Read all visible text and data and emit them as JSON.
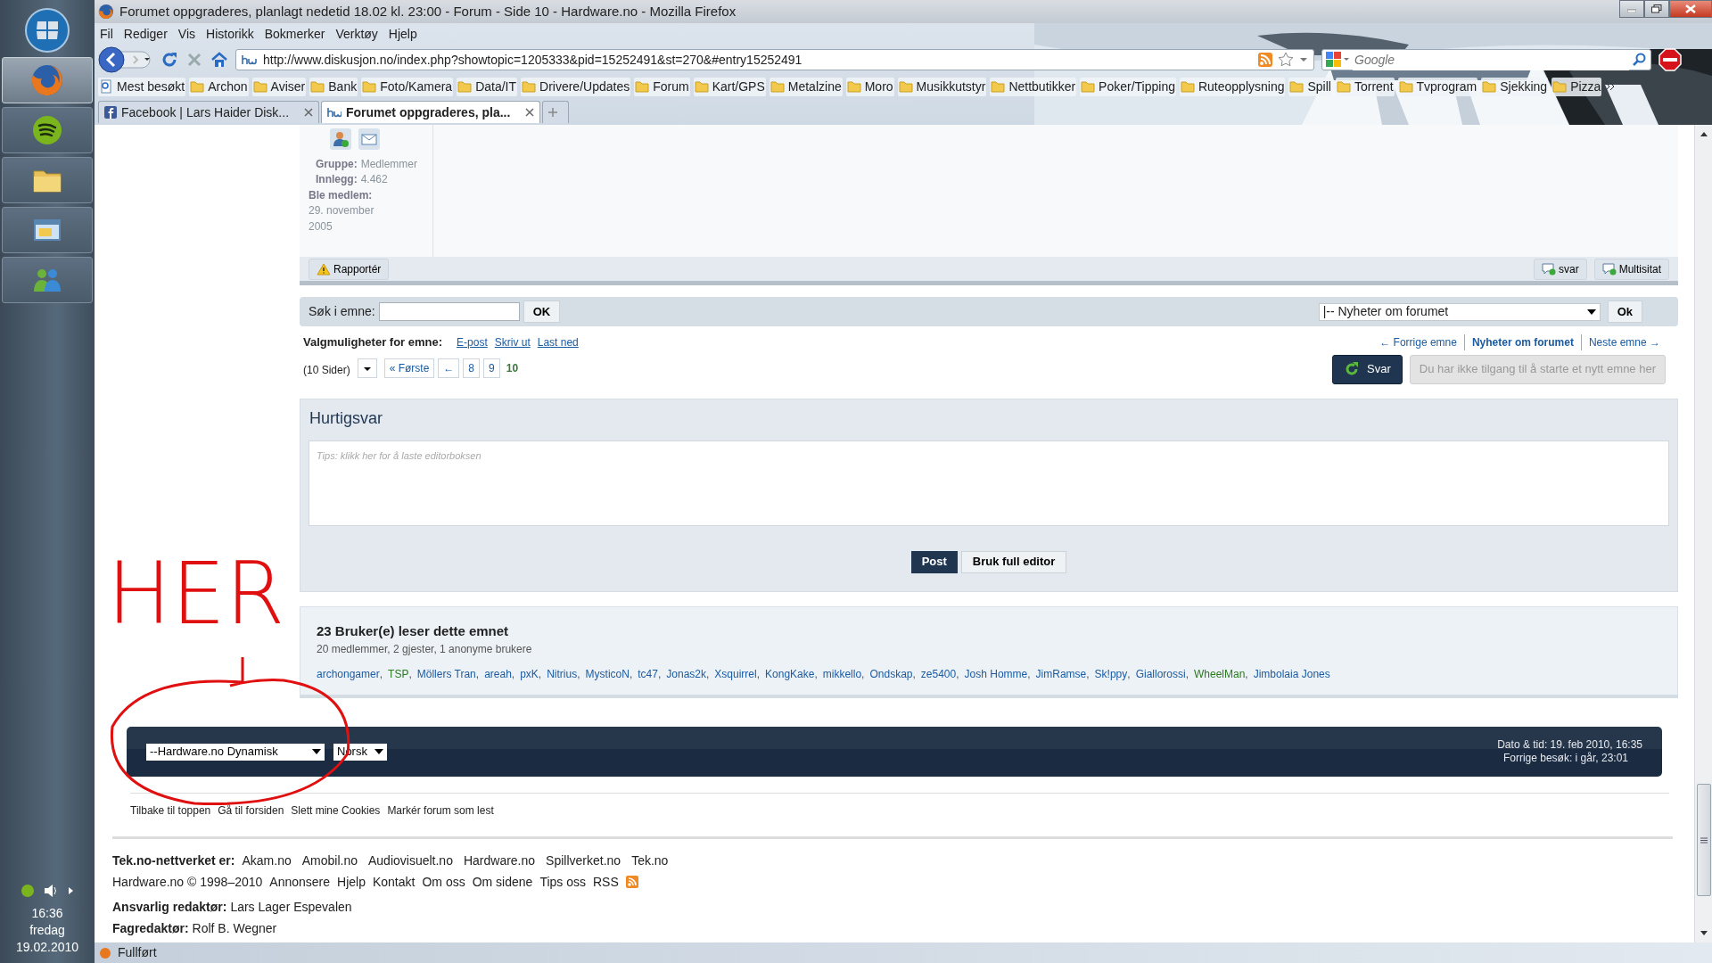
{
  "taskbar": {
    "apps": [
      {
        "kind": "firefox",
        "selected": true
      },
      {
        "kind": "spotify",
        "selected": false
      },
      {
        "kind": "folder",
        "selected": false
      },
      {
        "kind": "window",
        "selected": false
      },
      {
        "kind": "people",
        "selected": false
      }
    ]
  },
  "clock": {
    "time": "16:36",
    "day": "fredag",
    "date": "19.02.2010"
  },
  "window": {
    "title": "Forumet oppgraderes, planlagt nedetid 18.02 kl. 23:00 - Forum - Side 10 - Hardware.no - Mozilla Firefox"
  },
  "menu": [
    "Fil",
    "Rediger",
    "Vis",
    "Historikk",
    "Bokmerker",
    "Verktøy",
    "Hjelp"
  ],
  "address": {
    "url": "http://www.diskusjon.no/index.php?showtopic=1205333&pid=15252491&st=270&#entry15252491"
  },
  "search": {
    "placeholder": "Google"
  },
  "bookmarks": [
    "Mest besøkt",
    "Archon",
    "Aviser",
    "Bank",
    "Foto/Kamera",
    "Data/IT",
    "Drivere/Updates",
    "Forum",
    "Kart/GPS",
    "Metalzine",
    "Moro",
    "Musikkutstyr",
    "Nettbutikker",
    "Poker/Tipping",
    "Ruteopplysning",
    "Spill",
    "Torrent",
    "Tvprogram",
    "Sjekking",
    "Pizza"
  ],
  "tabs": [
    {
      "label": "Facebook | Lars Haider Disk...",
      "selected": false,
      "kind": "facebook"
    },
    {
      "label": "Forumet oppgraderes, pla...",
      "selected": true,
      "kind": "hw"
    }
  ],
  "post": {
    "profile": [
      {
        "label": "Gruppe:",
        "value": "Medlemmer"
      },
      {
        "label": "Innlegg:",
        "value": "4.462"
      }
    ],
    "joined_label": "Ble medlem:",
    "joined": "29. november 2005",
    "report": "Rapportér",
    "actions": [
      "svar",
      "Multisitat"
    ]
  },
  "topic_search": {
    "label": "Søk i emne:",
    "button": "OK",
    "forum_select": "|-- Nyheter om forumet",
    "go": "Ok"
  },
  "options": {
    "label": "Valgmuligheter for emne:",
    "links": [
      "E-post",
      "Skriv ut",
      "Last ned"
    ]
  },
  "topic_nav": [
    {
      "label": "← Forrige emne",
      "current": false
    },
    {
      "label": "Nyheter om forumet",
      "current": true
    },
    {
      "label": "Neste emne →",
      "current": false
    }
  ],
  "pagination": {
    "pages_label": "(10 Sider)",
    "first": "« Første",
    "prev": "←",
    "pages": [
      {
        "label": "8",
        "selected": false
      },
      {
        "label": "9",
        "selected": false
      },
      {
        "label": "10",
        "selected": true
      }
    ]
  },
  "reply_button": "Svar",
  "new_topic_button": {
    "label": "Du har ikke tilgang til å starte et nytt emne her",
    "disabled": true
  },
  "quick_reply": {
    "title": "Hurtigsvar",
    "placeholder": "Tips: klikk her for å laste editorboksen",
    "buttons": [
      "Post",
      "Bruk full editor"
    ]
  },
  "readers": {
    "separator": ",",
    "title": "23 Bruker(e) leser dette emnet",
    "summary": "20 medlemmer, 2 gjester, 1 anonyme brukere",
    "users": [
      {
        "name": "archongamer",
        "color": "#1d5ba0"
      },
      {
        "name": "TSP",
        "color": "#2a7a1e"
      },
      {
        "name": "Möllers Tran",
        "color": "#1d5ba0"
      },
      {
        "name": "areah",
        "color": "#1d5ba0"
      },
      {
        "name": "pxK",
        "color": "#1d5ba0"
      },
      {
        "name": "Nitrius",
        "color": "#1d5ba0"
      },
      {
        "name": "MysticoN",
        "color": "#1d5ba0"
      },
      {
        "name": "tc47",
        "color": "#1d5ba0"
      },
      {
        "name": "Jonas2k",
        "color": "#1d5ba0"
      },
      {
        "name": "Xsquirrel",
        "color": "#1d5ba0"
      },
      {
        "name": "KongKake",
        "color": "#1d5ba0"
      },
      {
        "name": "mikkello",
        "color": "#1d5ba0"
      },
      {
        "name": "Ondskap",
        "color": "#1d5ba0"
      },
      {
        "name": "ze5400",
        "color": "#1d5ba0"
      },
      {
        "name": "Josh Homme",
        "color": "#1d5ba0"
      },
      {
        "name": "JimRamse",
        "color": "#1d5ba0"
      },
      {
        "name": "Sk!ppy",
        "color": "#1d5ba0"
      },
      {
        "name": "Giallorossi",
        "color": "#1d5ba0"
      },
      {
        "name": "WheelMan",
        "color": "#2a7a1e"
      },
      {
        "name": "Jimbolaia Jones",
        "color": "#1d5ba0"
      }
    ]
  },
  "footer_bar": {
    "skin": "--Hardware.no Dynamisk",
    "language": "Norsk",
    "datetime": "Dato & tid: 19. feb 2010, 16:35",
    "last_visit": "Forrige besøk: i går, 23:01"
  },
  "footer_links": [
    "Tilbake til toppen",
    "Gå til forsiden",
    "Slett mine Cookies",
    "Markér forum som lest"
  ],
  "network": {
    "label": "Tek.no-nettverket er:",
    "sites": [
      "Akam.no",
      "Amobil.no",
      "Audiovisuelt.no",
      "Hardware.no",
      "Spillverket.no",
      "Tek.no"
    ]
  },
  "copyright": "Hardware.no © 1998–2010",
  "site_links": [
    "Annonsere",
    "Hjelp",
    "Kontakt",
    "Om oss",
    "Om sidene",
    "Tips oss",
    "RSS"
  ],
  "credits": [
    {
      "role": "Ansvarlig redaktør:",
      "name": "Lars Lager Espevalen"
    },
    {
      "role": "Fagredaktør:",
      "name": "Rolf B. Wegner"
    }
  ],
  "annotation": {
    "text": "HER"
  },
  "status_bar": {
    "text": "Fullført"
  }
}
